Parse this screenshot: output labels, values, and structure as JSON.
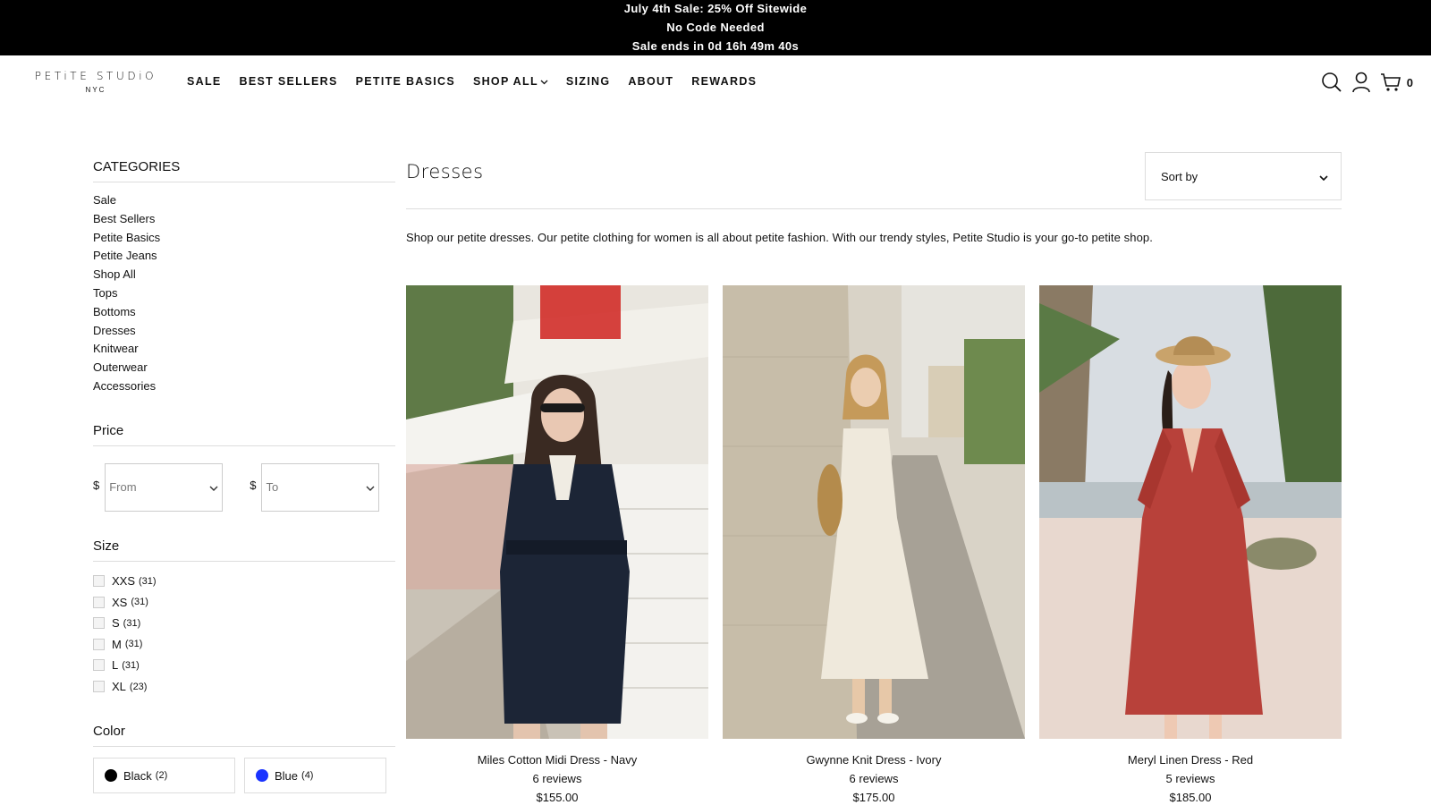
{
  "announcement": {
    "line1": "July 4th Sale: 25% Off Sitewide",
    "line2": "No Code Needed",
    "line3": "Sale ends in 0d 16h 49m 40s"
  },
  "logo": {
    "line1": "PETiTE STUDiO",
    "line2": "NYC"
  },
  "nav": [
    "SALE",
    "BEST SELLERS",
    "PETITE BASICS",
    "SHOP ALL",
    "SIZING",
    "ABOUT",
    "REWARDS"
  ],
  "header": {
    "cart_count": "0",
    "icons": [
      "search-icon",
      "account-icon",
      "cart-icon"
    ]
  },
  "sidebar": {
    "categories_title": "CATEGORIES",
    "categories": [
      "Sale",
      "Best Sellers",
      "Petite Basics",
      "Petite Jeans",
      "Shop All",
      "Tops",
      "Bottoms",
      "Dresses",
      "Knitwear",
      "Outerwear",
      "Accessories"
    ],
    "price_title": "Price",
    "currency": "$",
    "from_placeholder": "From",
    "to_placeholder": "To",
    "size_title": "Size",
    "sizes": [
      {
        "label": "XXS",
        "count": "(31)"
      },
      {
        "label": "XS",
        "count": "(31)"
      },
      {
        "label": "S",
        "count": "(31)"
      },
      {
        "label": "M",
        "count": "(31)"
      },
      {
        "label": "L",
        "count": "(31)"
      },
      {
        "label": "XL",
        "count": "(23)"
      }
    ],
    "color_title": "Color",
    "colors": [
      {
        "label": "Black",
        "count": "(2)",
        "hex": "#000000"
      },
      {
        "label": "Blue",
        "count": "(4)",
        "hex": "#1a33ff"
      }
    ]
  },
  "main": {
    "title": "Dresses",
    "sort_label": "Sort by",
    "description": "Shop our petite dresses. Our petite clothing for women is all about petite fashion. With our trendy styles, Petite Studio is your go-to petite shop.",
    "products": [
      {
        "name": "Miles Cotton Midi Dress - Navy",
        "reviews": "6 reviews",
        "price": "$155.00"
      },
      {
        "name": "Gwynne Knit Dress - Ivory",
        "reviews": "6 reviews",
        "price": "$175.00"
      },
      {
        "name": "Meryl Linen Dress - Red",
        "reviews": "5 reviews",
        "price": "$185.00"
      }
    ]
  }
}
